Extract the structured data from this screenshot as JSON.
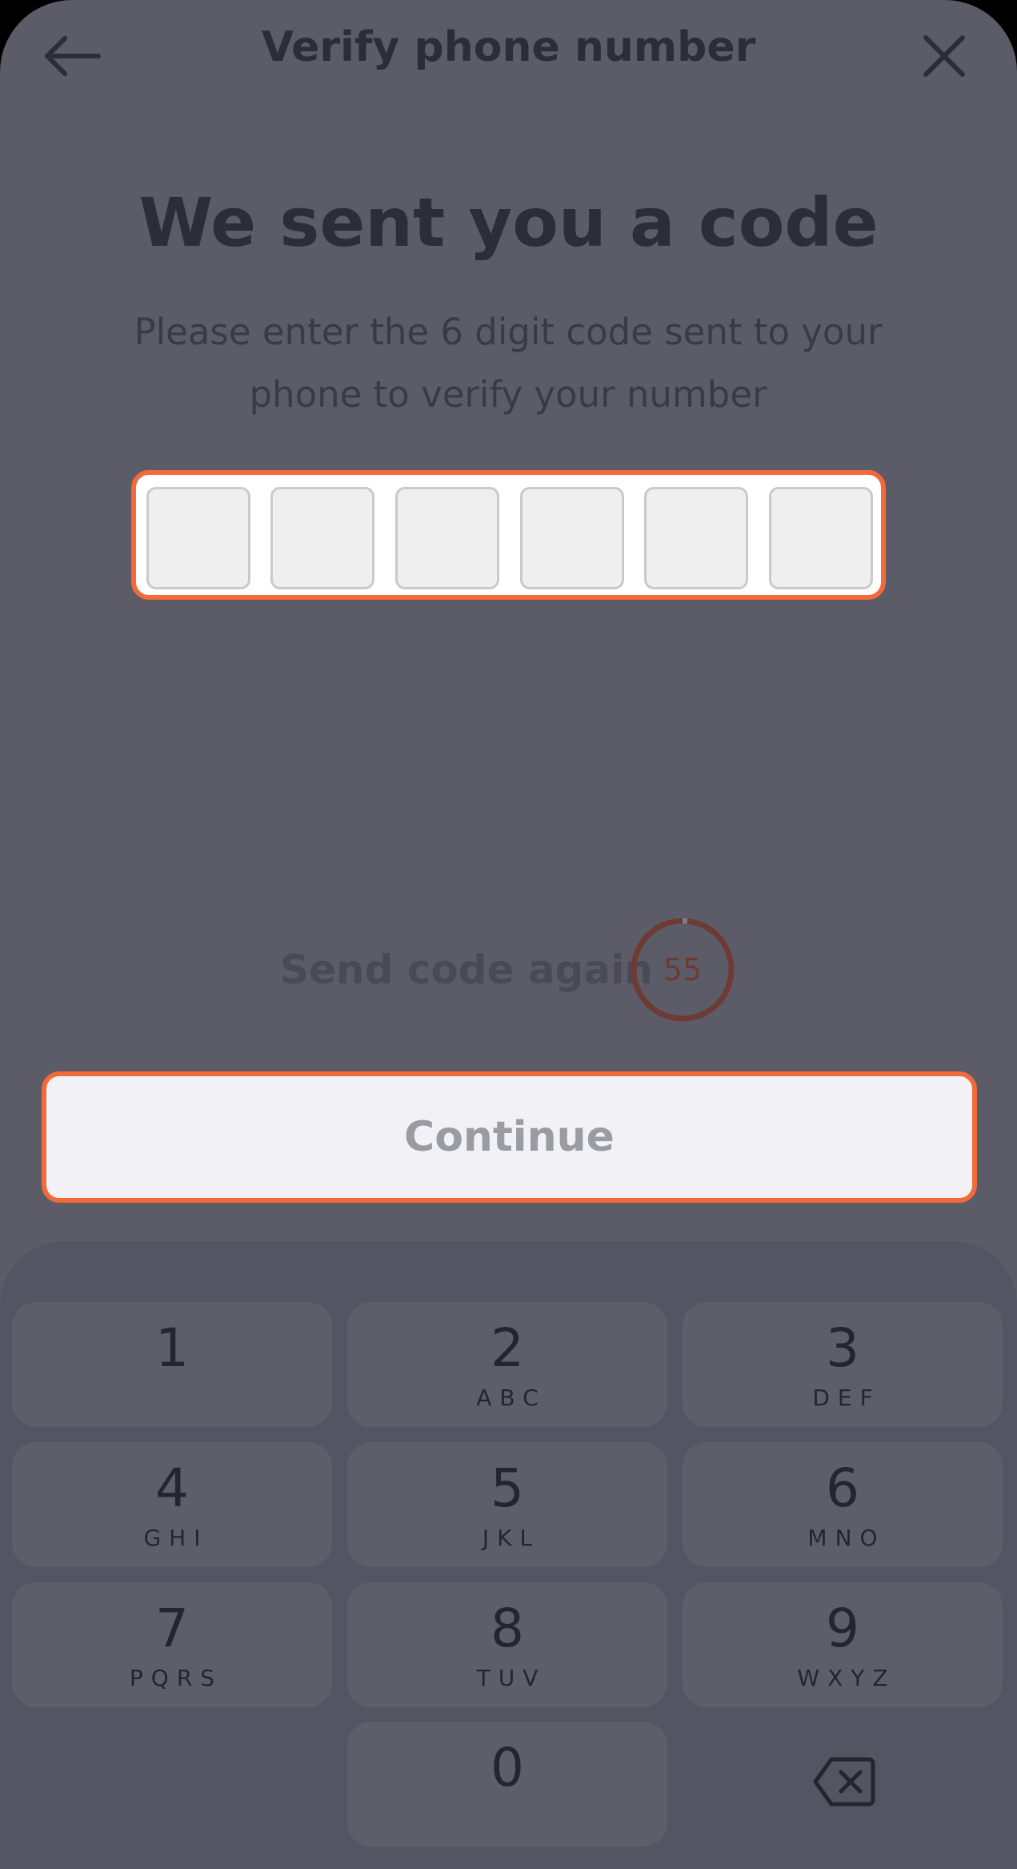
{
  "header": {
    "title": "Verify phone number",
    "back_icon": "arrow-left-icon",
    "close_icon": "close-icon"
  },
  "main": {
    "headline": "We sent you a code",
    "subtitle_line1": "Please enter the 6 digit code sent to your",
    "subtitle_line2": "phone to verify your number",
    "code_cells": [
      "",
      "",
      "",
      "",
      "",
      ""
    ],
    "resend_label": "Send code again",
    "timer_seconds": "55",
    "continue_label": "Continue"
  },
  "keypad": {
    "keys": [
      {
        "digit": "1",
        "letters": ""
      },
      {
        "digit": "2",
        "letters": "ABC"
      },
      {
        "digit": "3",
        "letters": "DEF"
      },
      {
        "digit": "4",
        "letters": "GHI"
      },
      {
        "digit": "5",
        "letters": "JKL"
      },
      {
        "digit": "6",
        "letters": "MNO"
      },
      {
        "digit": "7",
        "letters": "PQRS"
      },
      {
        "digit": "8",
        "letters": "TUV"
      },
      {
        "digit": "9",
        "letters": "WXYZ"
      },
      {
        "digit": "0",
        "letters": ""
      }
    ],
    "delete_icon": "backspace-icon"
  },
  "colors": {
    "overlay_bg": "#5c5c69",
    "accent_outline": "#f26a3a",
    "timer_ring": "#6e3a34"
  }
}
